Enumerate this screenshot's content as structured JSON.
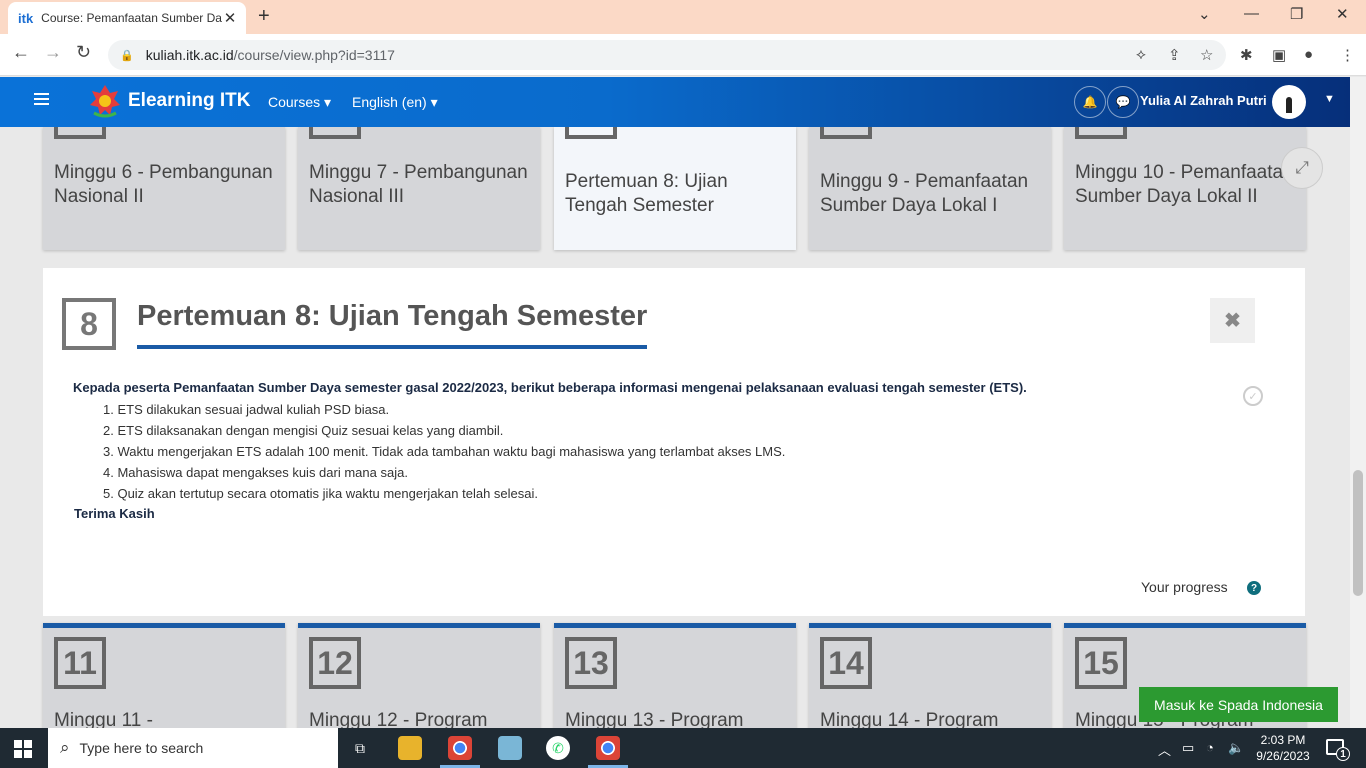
{
  "browser": {
    "tab_favicon": "itk",
    "tab_title": "Course: Pemanfaatan Sumber Daya",
    "tab_close": "✕",
    "new_tab": "+",
    "url_host": "kuliah.itk.ac.id",
    "url_path": "/course/view.php?id=3117"
  },
  "navbar": {
    "brand": "Elearning ITK",
    "menu_courses": "Courses",
    "menu_language": "English (en)",
    "user_name": "Yulia Al Zahrah Putri",
    "color_start": "#0a72d8",
    "color_end": "#062f7a"
  },
  "top_cards": [
    {
      "title": "Minggu 6 - Pembangunan Nasional II"
    },
    {
      "title": "Minggu 7 - Pembangunan Nasional III"
    },
    {
      "title": "Pertemuan 8: Ujian Tengah Semester"
    },
    {
      "title": "Minggu 9 - Pemanfaatan Sumber Daya Lokal I"
    },
    {
      "title": "Minggu 10 - Pemanfaatan Sumber Daya Lokal II"
    }
  ],
  "section": {
    "number": "8",
    "title": "Pertemuan 8: Ujian Tengah Semester",
    "close": "✖",
    "intro": "Kepada peserta Pemanfaatan Sumber Daya semester gasal 2022/2023, berikut beberapa informasi mengenai pelaksanaan evaluasi tengah semester (ETS).",
    "items": [
      "1. ETS dilakukan sesuai jadwal kuliah PSD biasa.",
      "2. ETS dilaksanakan dengan mengisi Quiz sesuai kelas yang diambil.",
      "3. Waktu mengerjakan ETS adalah 100 menit. Tidak ada tambahan waktu bagi mahasiswa yang terlambat akses LMS.",
      "4. Mahasiswa dapat mengakses kuis dari mana saja.",
      "5. Quiz akan tertutup secara otomatis jika waktu mengerjakan telah selesai."
    ],
    "closing": "Terima Kasih",
    "progress_label": "Your progress",
    "help": "?"
  },
  "bottom_cards": [
    {
      "number": "11",
      "title": "Minggu 11 -"
    },
    {
      "number": "12",
      "title": "Minggu 12 - Program"
    },
    {
      "number": "13",
      "title": "Minggu 13 - Program"
    },
    {
      "number": "14",
      "title": "Minggu 14 - Program"
    },
    {
      "number": "15",
      "title": "Minggu 15 - Program"
    }
  ],
  "spada_button": "Masuk ke Spada Indonesia",
  "taskbar": {
    "search_placeholder": "Type here to search",
    "time": "2:03 PM",
    "date": "9/26/2023",
    "notification_count": "1"
  }
}
